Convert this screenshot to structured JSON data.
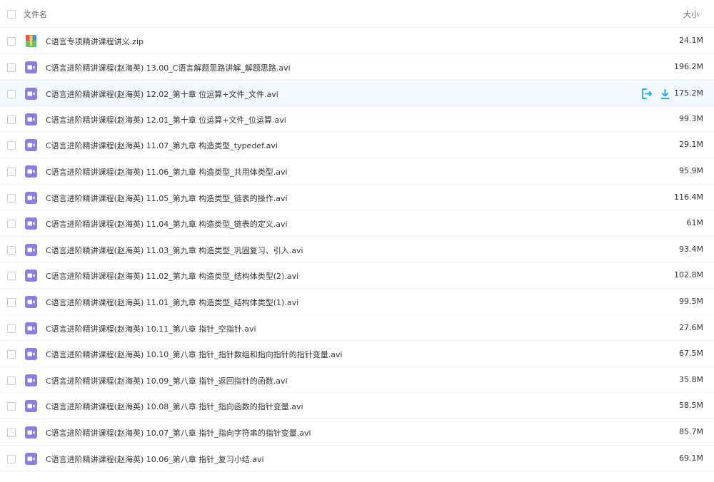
{
  "header": {
    "name_label": "文件名",
    "size_label": "大小"
  },
  "files": [
    {
      "name": "C语言专项精讲课程讲义.zip",
      "size": "24.1M",
      "icon": "zip-archive-icon"
    },
    {
      "name": "C语言进阶精讲课程(赵海英) 13.00_C语言解题思路讲解_解题思路.avi",
      "size": "196.2M",
      "icon": "video-file-icon"
    },
    {
      "name": "C语言进阶精讲课程(赵海英) 12.02_第十章 位运算+文件_文件.avi",
      "size": "175.2M",
      "icon": "video-file-icon",
      "hovered": true
    },
    {
      "name": "C语言进阶精讲课程(赵海英) 12.01_第十章 位运算+文件_位运算.avi",
      "size": "99.3M",
      "icon": "video-file-icon"
    },
    {
      "name": "C语言进阶精讲课程(赵海英) 11.07_第九章 构造类型_typedef.avi",
      "size": "29.1M",
      "icon": "video-file-icon"
    },
    {
      "name": "C语言进阶精讲课程(赵海英) 11.06_第九章 构造类型_共用体类型.avi",
      "size": "95.9M",
      "icon": "video-file-icon"
    },
    {
      "name": "C语言进阶精讲课程(赵海英) 11.05_第九章 构造类型_链表的操作.avi",
      "size": "116.4M",
      "icon": "video-file-icon"
    },
    {
      "name": "C语言进阶精讲课程(赵海英) 11.04_第九章 构造类型_链表的定义.avi",
      "size": "61M",
      "icon": "video-file-icon"
    },
    {
      "name": "C语言进阶精讲课程(赵海英) 11.03_第九章 构造类型_巩固复习、引入.avi",
      "size": "93.4M",
      "icon": "video-file-icon"
    },
    {
      "name": "C语言进阶精讲课程(赵海英) 11.02_第九章 构造类型_结构体类型(2).avi",
      "size": "102.8M",
      "icon": "video-file-icon"
    },
    {
      "name": "C语言进阶精讲课程(赵海英) 11.01_第九章 构造类型_结构体类型(1).avi",
      "size": "99.5M",
      "icon": "video-file-icon"
    },
    {
      "name": "C语言进阶精讲课程(赵海英) 10.11_第八章 指针_空指针.avi",
      "size": "27.6M",
      "icon": "video-file-icon"
    },
    {
      "name": "C语言进阶精讲课程(赵海英) 10.10_第八章 指针_指针数组和指向指针的指针变量.avi",
      "size": "67.5M",
      "icon": "video-file-icon"
    },
    {
      "name": "C语言进阶精讲课程(赵海英) 10.09_第八章 指针_返回指针的函数.avi",
      "size": "35.8M",
      "icon": "video-file-icon"
    },
    {
      "name": "C语言进阶精讲课程(赵海英) 10.08_第八章 指针_指向函数的指针变量.avi",
      "size": "58.5M",
      "icon": "video-file-icon"
    },
    {
      "name": "C语言进阶精讲课程(赵海英) 10.07_第八章 指针_指向字符串的指针变量.avi",
      "size": "85.7M",
      "icon": "video-file-icon"
    },
    {
      "name": "C语言进阶精讲课程(赵海英) 10.06_第八章 指针_复习小结.avi",
      "size": "69.1M",
      "icon": "video-file-icon"
    }
  ],
  "row_actions": [
    "share-icon",
    "download-icon"
  ],
  "colors": {
    "accent": "#09aaff",
    "video_icon": "#8c7ce6",
    "hover_row": "#f4f9ff"
  }
}
